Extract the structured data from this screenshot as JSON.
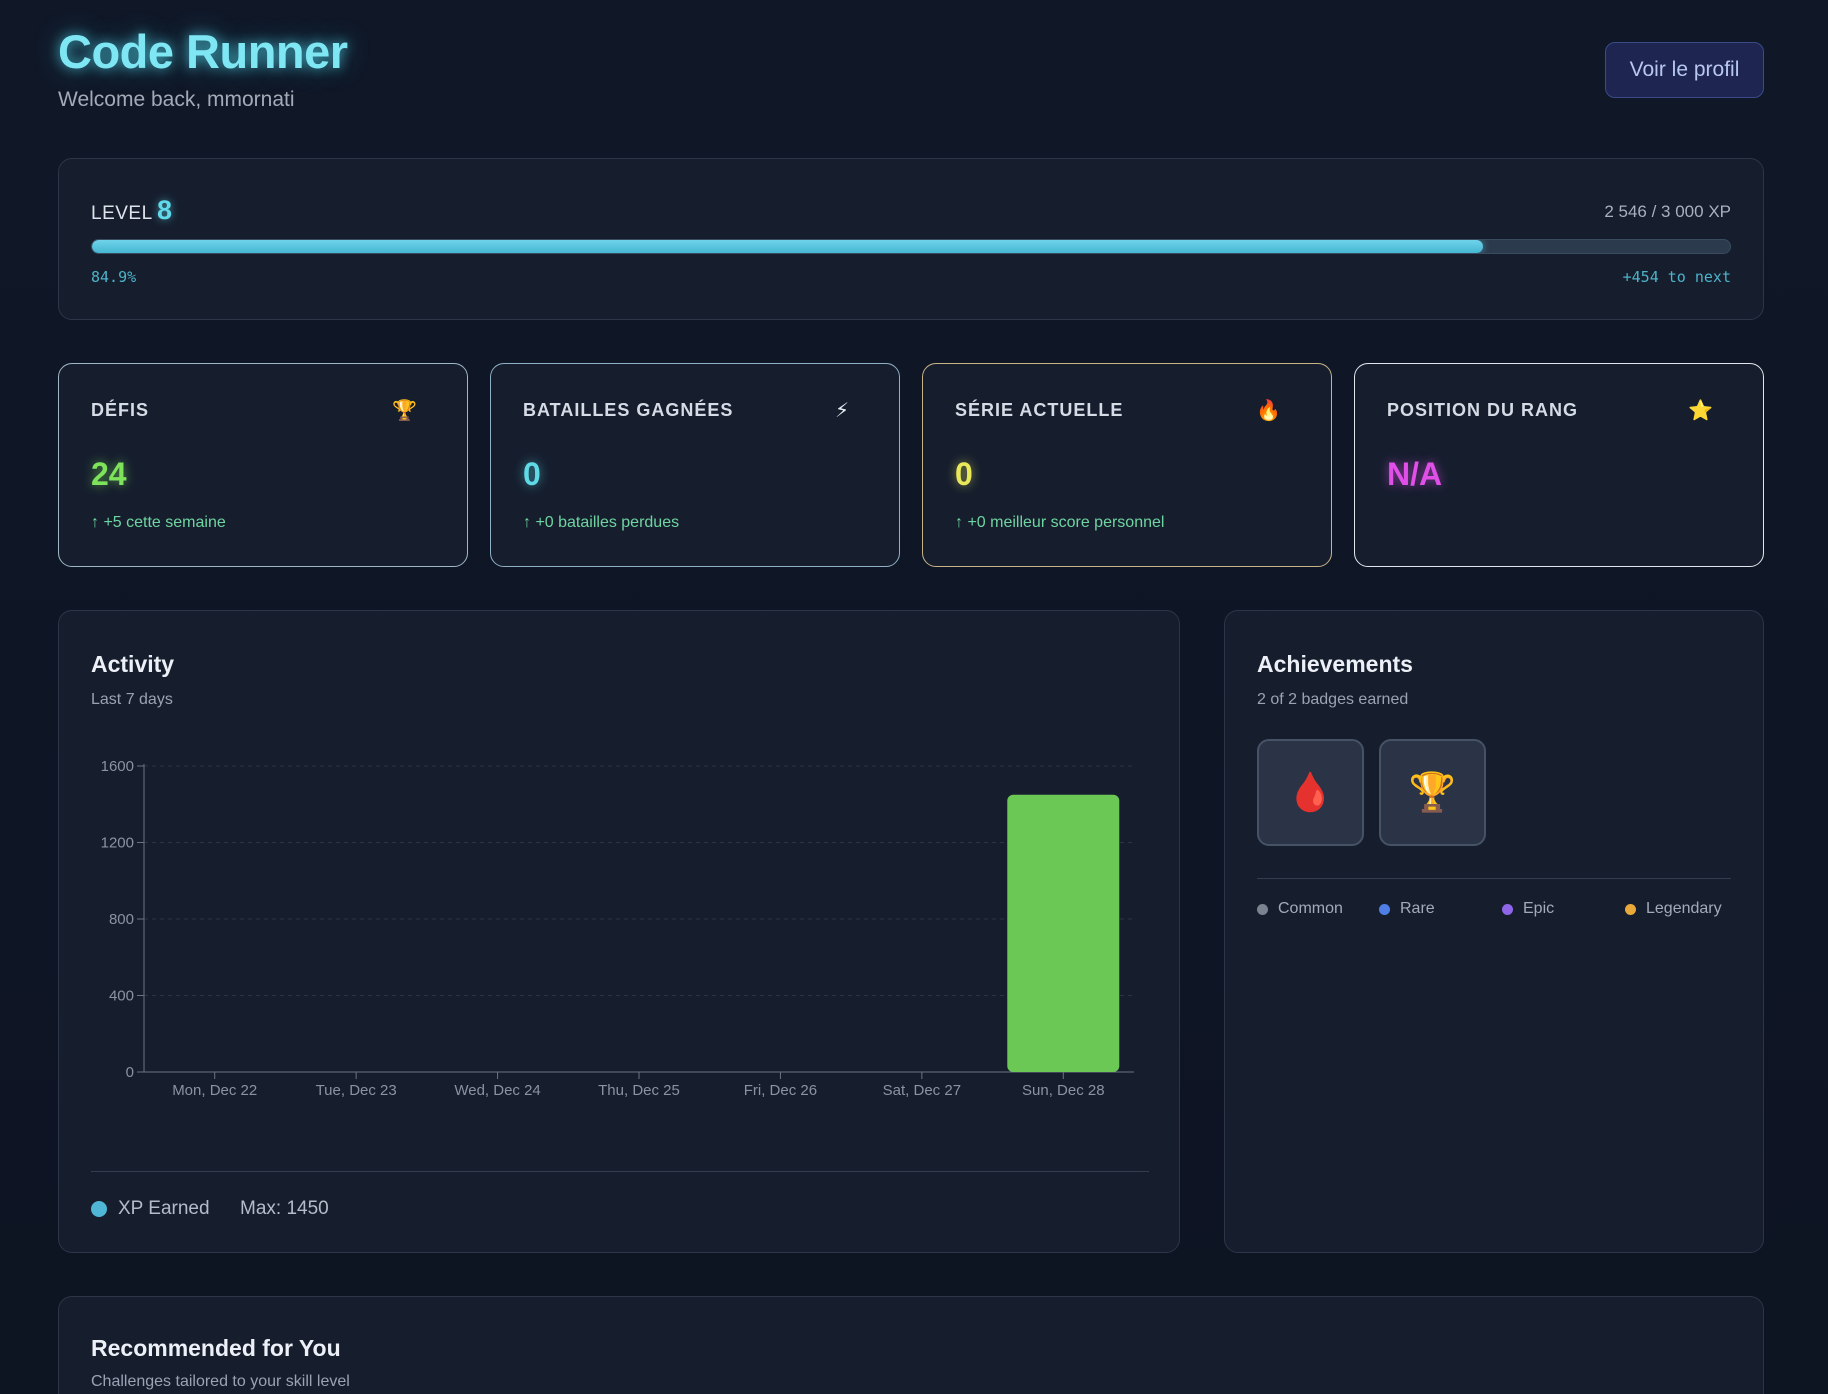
{
  "header": {
    "app_title": "Code Runner",
    "welcome": "Welcome back, mmornati",
    "profile_button": "Voir le profil"
  },
  "level": {
    "label": "LEVEL",
    "number": "8",
    "xp_text": "2 546 / 3 000 XP",
    "progress_fraction": 0.849,
    "percent_text": "84.9%",
    "next_text": "+454 to next"
  },
  "stats": [
    {
      "label": "DÉFIS",
      "icon": "trophy-icon",
      "glyph": "🏆",
      "value": "24",
      "sub": "↑ +5 cette semaine",
      "value_color": "#7ee35a",
      "border_color": "#9fb8c6"
    },
    {
      "label": "BATAILLES GAGNÉES",
      "icon": "lightning-icon",
      "glyph": "⚡",
      "value": "0",
      "sub": "↑ +0 batailles perdues",
      "value_color": "#5fdbe8",
      "border_color": "#8fb0c6"
    },
    {
      "label": "SÉRIE ACTUELLE",
      "icon": "fire-icon",
      "glyph": "🔥",
      "value": "0",
      "sub": "↑ +0 meilleur score personnel",
      "value_color": "#e8e85a",
      "border_color": "#c9b488"
    },
    {
      "label": "POSITION DU RANG",
      "icon": "star-icon",
      "glyph": "⭐",
      "value": "N/A",
      "sub": "",
      "value_color": "#e04fe8",
      "border_color": "#e2e6ec"
    }
  ],
  "activity": {
    "title": "Activity",
    "subtitle": "Last 7 days",
    "legend_label": "XP Earned",
    "max_label": "Max: 1450",
    "series_color": "#4fb6d6",
    "bar_color": "#6cc855"
  },
  "chart_data": {
    "type": "bar",
    "categories": [
      "Mon, Dec 22",
      "Tue, Dec 23",
      "Wed, Dec 24",
      "Thu, Dec 25",
      "Fri, Dec 26",
      "Sat, Dec 27",
      "Sun, Dec 28"
    ],
    "series": [
      {
        "name": "XP Earned",
        "values": [
          0,
          0,
          0,
          0,
          0,
          0,
          1450
        ]
      }
    ],
    "yticks": [
      0,
      400,
      800,
      1200,
      1600
    ],
    "ylim": [
      0,
      1600
    ],
    "grid": true,
    "legend": "bottom-left"
  },
  "achievements": {
    "title": "Achievements",
    "subtitle": "2 of 2 badges earned",
    "badges": [
      {
        "icon": "blood-drop-icon",
        "glyph": "🩸"
      },
      {
        "icon": "trophy-icon",
        "glyph": "🏆"
      }
    ],
    "rarities": [
      {
        "label": "Common",
        "color": "#7b8290"
      },
      {
        "label": "Rare",
        "color": "#4f7fe6"
      },
      {
        "label": "Epic",
        "color": "#9066e8"
      },
      {
        "label": "Legendary",
        "color": "#e8a93a"
      }
    ]
  },
  "recommended": {
    "title": "Recommended for You",
    "subtitle": "Challenges tailored to your skill level"
  }
}
